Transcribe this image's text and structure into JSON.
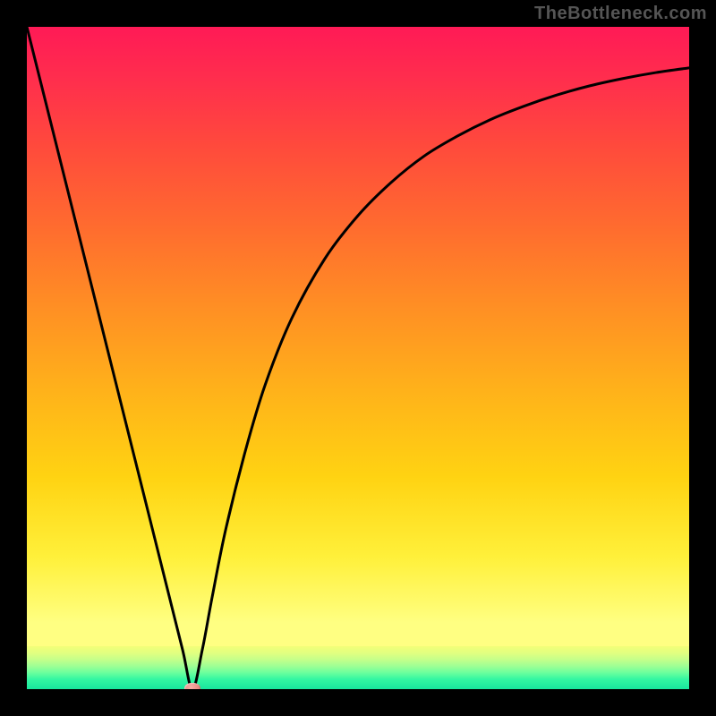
{
  "attribution": "TheBottleneck.com",
  "chart_data": {
    "type": "line",
    "title": "",
    "xlabel": "",
    "ylabel": "",
    "xlim": [
      0,
      100
    ],
    "ylim": [
      0,
      100
    ],
    "x": [
      0,
      3,
      6,
      9,
      12,
      15,
      18,
      21,
      23.5,
      25,
      26.5,
      28,
      30,
      33,
      36,
      40,
      45,
      50,
      55,
      60,
      65,
      70,
      75,
      80,
      85,
      90,
      95,
      100
    ],
    "values": [
      100,
      88,
      76,
      64,
      52,
      40,
      28,
      16,
      6,
      0,
      6,
      14,
      24,
      36,
      46,
      56,
      65,
      71.5,
      76.5,
      80.5,
      83.5,
      86,
      88,
      89.7,
      91.1,
      92.2,
      93.1,
      93.8
    ],
    "marker": {
      "x": 25,
      "y": 0
    },
    "bands": [
      {
        "name": "main-gradient",
        "from": 100,
        "to": 6.5
      },
      {
        "name": "green-band",
        "from": 6.5,
        "to": 0
      }
    ]
  }
}
